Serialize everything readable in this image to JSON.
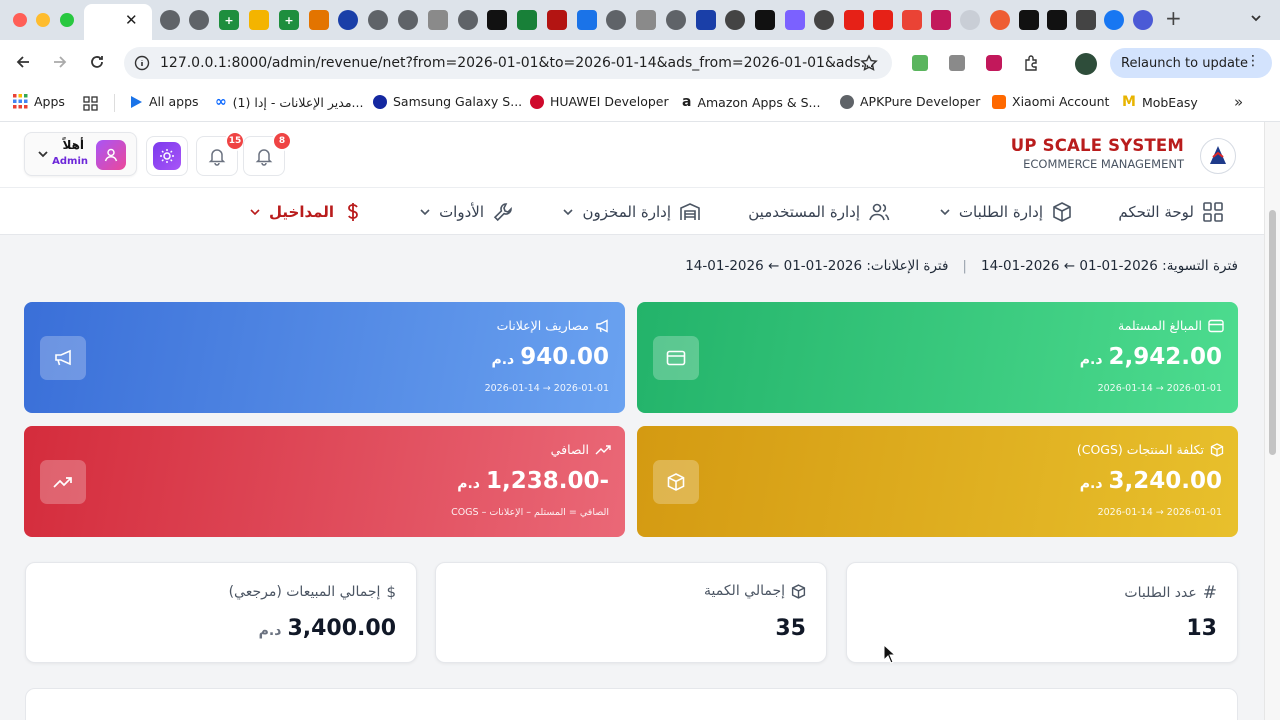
{
  "browser": {
    "url": "127.0.0.1:8000/admin/revenue/net?from=2026-01-01&to=2026-01-14&ads_from=2026-01-01&ads...",
    "relaunch_label": "Relaunch to update",
    "bookmarks": [
      {
        "label": "Apps"
      },
      {
        "label": "All apps"
      },
      {
        "label": "(1) مدير الإعلانات - إدا..."
      },
      {
        "label": "Samsung Galaxy S..."
      },
      {
        "label": "HUAWEI Developer"
      },
      {
        "label": "Amazon Apps & S..."
      },
      {
        "label": "APKPure Developer"
      },
      {
        "label": "Xiaomi Account"
      },
      {
        "label": "MobEasy"
      }
    ]
  },
  "brand": {
    "name": "UP SCALE SYSTEM",
    "tagline": "ECOMMERCE MANAGEMENT"
  },
  "user": {
    "greeting": "أهلاً",
    "role": "Admin"
  },
  "notifications": {
    "count_a": "15",
    "count_b": "8"
  },
  "nav": [
    {
      "label": "لوحة التحكم"
    },
    {
      "label": "إدارة الطلبات"
    },
    {
      "label": "إدارة المستخدمين"
    },
    {
      "label": "إدارة المخزون"
    },
    {
      "label": "الأدوات"
    },
    {
      "label": "المداخيل"
    }
  ],
  "period": {
    "settlement": "فترة التسوية: 2026-01-01 ← 2026-01-14",
    "separator": "|",
    "ads": "فترة الإعلانات: 2026-01-01 ← 2026-01-14"
  },
  "cards": {
    "received": {
      "title": "المبالغ المستلمة",
      "value": "2,942.00",
      "currency": "د.م",
      "range": "2026-01-01 → 2026-01-14",
      "color_from": "#23b36a",
      "color_to": "#4ddc8f"
    },
    "ads": {
      "title": "مصاريف الإعلانات",
      "value": "940.00",
      "currency": "د.م",
      "range": "2026-01-01 → 2026-01-14",
      "color_from": "#3a6fd8",
      "color_to": "#6aa2f0"
    },
    "cogs": {
      "title": "تكلفة المنتجات (COGS)",
      "value": "3,240.00",
      "currency": "د.م",
      "range": "2026-01-01 → 2026-01-14",
      "color_from": "#d49a12",
      "color_to": "#e8c02c"
    },
    "net": {
      "title": "الصافي",
      "value": "-1,238.00",
      "currency": "د.م",
      "range": "الصافي = المستلم – الإعلانات – COGS",
      "color_from": "#d42c3c",
      "color_to": "#ea6877"
    }
  },
  "stats": {
    "orders": {
      "title": "عدد الطلبات",
      "value": "13"
    },
    "quantity": {
      "title": "إجمالي الكمية",
      "value": "35"
    },
    "sales": {
      "title": "إجمالي المبيعات (مرجعي)",
      "value": "3,400.00",
      "currency": "د.م"
    }
  }
}
